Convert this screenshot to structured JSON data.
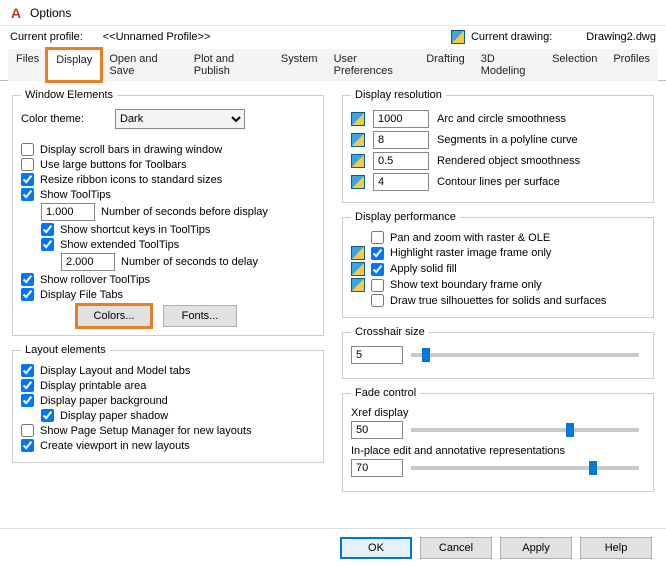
{
  "title": "Options",
  "profile": {
    "label": "Current profile:",
    "value": "<<Unnamed Profile>>"
  },
  "current_drawing": {
    "label": "Current drawing:",
    "value": "Drawing2.dwg"
  },
  "tabs": [
    "Files",
    "Display",
    "Open and Save",
    "Plot and Publish",
    "System",
    "User Preferences",
    "Drafting",
    "3D Modeling",
    "Selection",
    "Profiles"
  ],
  "active_tab": "Display",
  "window_elements": {
    "legend": "Window Elements",
    "color_theme_label": "Color theme:",
    "color_theme_value": "Dark",
    "cb_scroll": "Display scroll bars in drawing window",
    "cb_large_buttons": "Use large buttons for Toolbars",
    "cb_resize_ribbon": "Resize ribbon icons to standard sizes",
    "cb_show_tooltips": "Show ToolTips",
    "tooltip_seconds_value": "1.000",
    "tooltip_seconds_label": "Number of seconds before display",
    "cb_shortcut_keys": "Show shortcut keys in ToolTips",
    "cb_extended_tt": "Show extended ToolTips",
    "delay_seconds_value": "2.000",
    "delay_seconds_label": "Number of seconds to delay",
    "cb_rollover": "Show rollover ToolTips",
    "cb_file_tabs": "Display File Tabs",
    "btn_colors": "Colors...",
    "btn_fonts": "Fonts..."
  },
  "layout_elements": {
    "legend": "Layout elements",
    "cb_layout_tabs": "Display Layout and Model tabs",
    "cb_printable": "Display printable area",
    "cb_paper_bg": "Display paper background",
    "cb_paper_shadow": "Display paper shadow",
    "cb_page_setup": "Show Page Setup Manager for new layouts",
    "cb_viewport": "Create viewport in new layouts"
  },
  "display_resolution": {
    "legend": "Display resolution",
    "rows": [
      {
        "value": "1000",
        "label": "Arc and circle smoothness"
      },
      {
        "value": "8",
        "label": "Segments in a polyline curve"
      },
      {
        "value": "0.5",
        "label": "Rendered object smoothness"
      },
      {
        "value": "4",
        "label": "Contour lines per surface"
      }
    ]
  },
  "display_performance": {
    "legend": "Display performance",
    "cb_pan_zoom": "Pan and zoom with raster & OLE",
    "cb_highlight_raster": "Highlight raster image frame only",
    "cb_solid_fill": "Apply solid fill",
    "cb_text_boundary": "Show text boundary frame only",
    "cb_true_silhouettes": "Draw true silhouettes for solids and surfaces"
  },
  "crosshair": {
    "legend": "Crosshair size",
    "value": "5",
    "pct": 5
  },
  "fade": {
    "legend": "Fade control",
    "xref_label": "Xref display",
    "xref_value": "50",
    "xref_pct": 68,
    "inplace_label": "In-place edit and annotative representations",
    "inplace_value": "70",
    "inplace_pct": 78
  },
  "footer": {
    "ok": "OK",
    "cancel": "Cancel",
    "apply": "Apply",
    "help": "Help"
  }
}
